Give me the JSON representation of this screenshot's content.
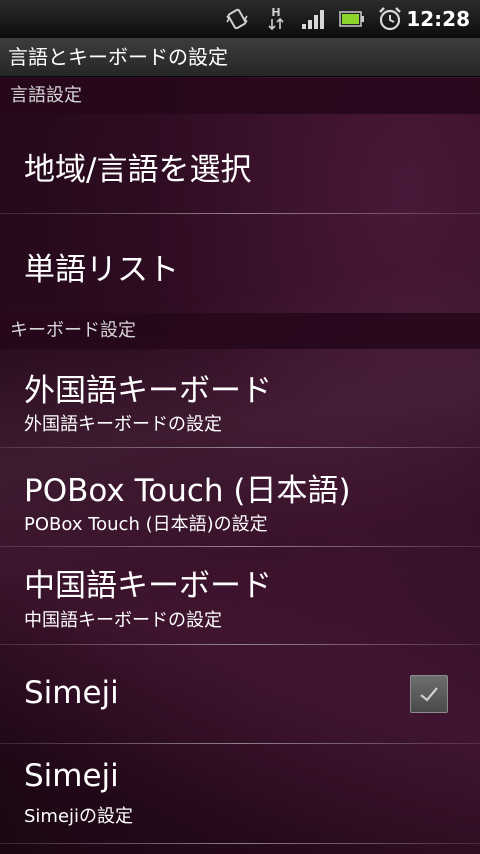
{
  "status_bar": {
    "time": "12:28",
    "network_type": "H",
    "icons": [
      "vibrate-icon",
      "data-transfer-icon",
      "signal-icon",
      "battery-icon",
      "alarm-icon"
    ]
  },
  "title_bar": {
    "title": "言語とキーボードの設定"
  },
  "sections": [
    {
      "header": "言語設定",
      "items": [
        {
          "title": "地域/言語を選択"
        },
        {
          "title": "単語リスト"
        }
      ]
    },
    {
      "header": "キーボード設定",
      "items": [
        {
          "title": "外国語キーボード",
          "summary": "外国語キーボードの設定"
        },
        {
          "title": "POBox Touch (日本語)",
          "summary": "POBox Touch (日本語)の設定"
        },
        {
          "title": "中国語キーボード",
          "summary": "中国語キーボードの設定"
        },
        {
          "title": "Simeji",
          "checked": true
        },
        {
          "title": "Simeji",
          "summary": "Simejiの設定"
        }
      ]
    }
  ],
  "colors": {
    "background": "#2e0c22",
    "text_primary": "#ffffff",
    "text_secondary": "#d6d6d6"
  }
}
